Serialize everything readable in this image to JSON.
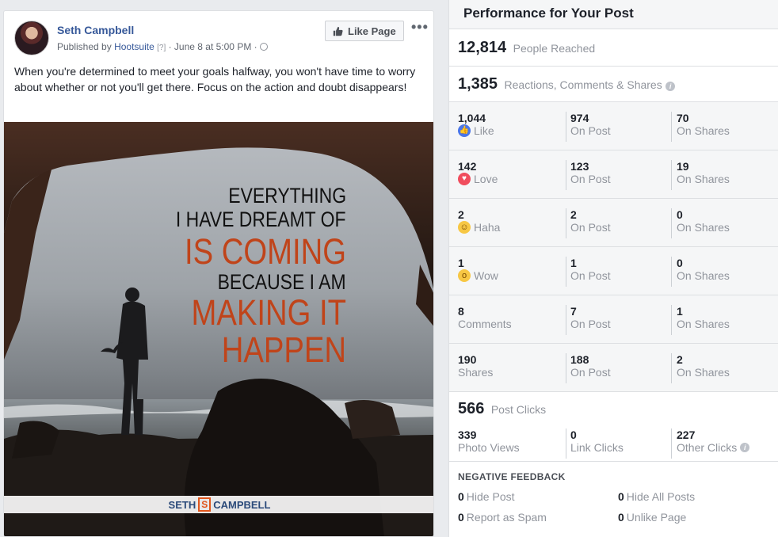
{
  "post": {
    "author": "Seth Campbell",
    "published_by_prefix": "Published by",
    "publisher": "Hootsuite",
    "publisher_flag": "[?]",
    "date": "June 8 at 5:00 PM",
    "like_page_label": "Like Page",
    "more_label": "•••",
    "text": "When you're determined to meet your goals halfway, you won't have time to worry about whether or not you'll get there. Focus on the action and doubt disappears!",
    "image": {
      "quote_lines": [
        "EVERYTHING",
        "I HAVE DREAMT OF",
        "IS COMING",
        "BECAUSE I AM",
        "MAKING IT",
        "HAPPEN"
      ],
      "brand_left": "SETH",
      "brand_mark": "S",
      "brand_right": "CAMPBELL"
    }
  },
  "panel": {
    "title": "Performance for Your Post",
    "reached": {
      "value": "12,814",
      "label": "People Reached"
    },
    "engagement": {
      "value": "1,385",
      "label": "Reactions, Comments & Shares"
    },
    "rows": [
      {
        "total": "1,044",
        "label": "Like",
        "icon": "like-icon",
        "on_post": "974",
        "on_post_label": "On Post",
        "on_shares": "70",
        "on_shares_label": "On Shares"
      },
      {
        "total": "142",
        "label": "Love",
        "icon": "love-icon",
        "on_post": "123",
        "on_post_label": "On Post",
        "on_shares": "19",
        "on_shares_label": "On Shares"
      },
      {
        "total": "2",
        "label": "Haha",
        "icon": "haha-icon",
        "on_post": "2",
        "on_post_label": "On Post",
        "on_shares": "0",
        "on_shares_label": "On Shares"
      },
      {
        "total": "1",
        "label": "Wow",
        "icon": "wow-icon",
        "on_post": "1",
        "on_post_label": "On Post",
        "on_shares": "0",
        "on_shares_label": "On Shares"
      },
      {
        "total": "8",
        "label": "Comments",
        "icon": "",
        "on_post": "7",
        "on_post_label": "On Post",
        "on_shares": "1",
        "on_shares_label": "On Shares"
      },
      {
        "total": "190",
        "label": "Shares",
        "icon": "",
        "on_post": "188",
        "on_post_label": "On Post",
        "on_shares": "2",
        "on_shares_label": "On Shares"
      }
    ],
    "clicks": {
      "value": "566",
      "label": "Post Clicks",
      "photo_views": "339",
      "photo_views_label": "Photo Views",
      "link_clicks": "0",
      "link_clicks_label": "Link Clicks",
      "other_clicks": "227",
      "other_clicks_label": "Other Clicks"
    },
    "negative": {
      "title": "NEGATIVE FEEDBACK",
      "hide_post": "0",
      "hide_post_label": "Hide Post",
      "hide_all": "0",
      "hide_all_label": "Hide All Posts",
      "spam": "0",
      "spam_label": "Report as Spam",
      "unlike": "0",
      "unlike_label": "Unlike Page"
    }
  },
  "colors": {
    "link": "#365899",
    "accent": "#c0441a",
    "like": "#4a76e8",
    "love": "#f04d5d"
  }
}
